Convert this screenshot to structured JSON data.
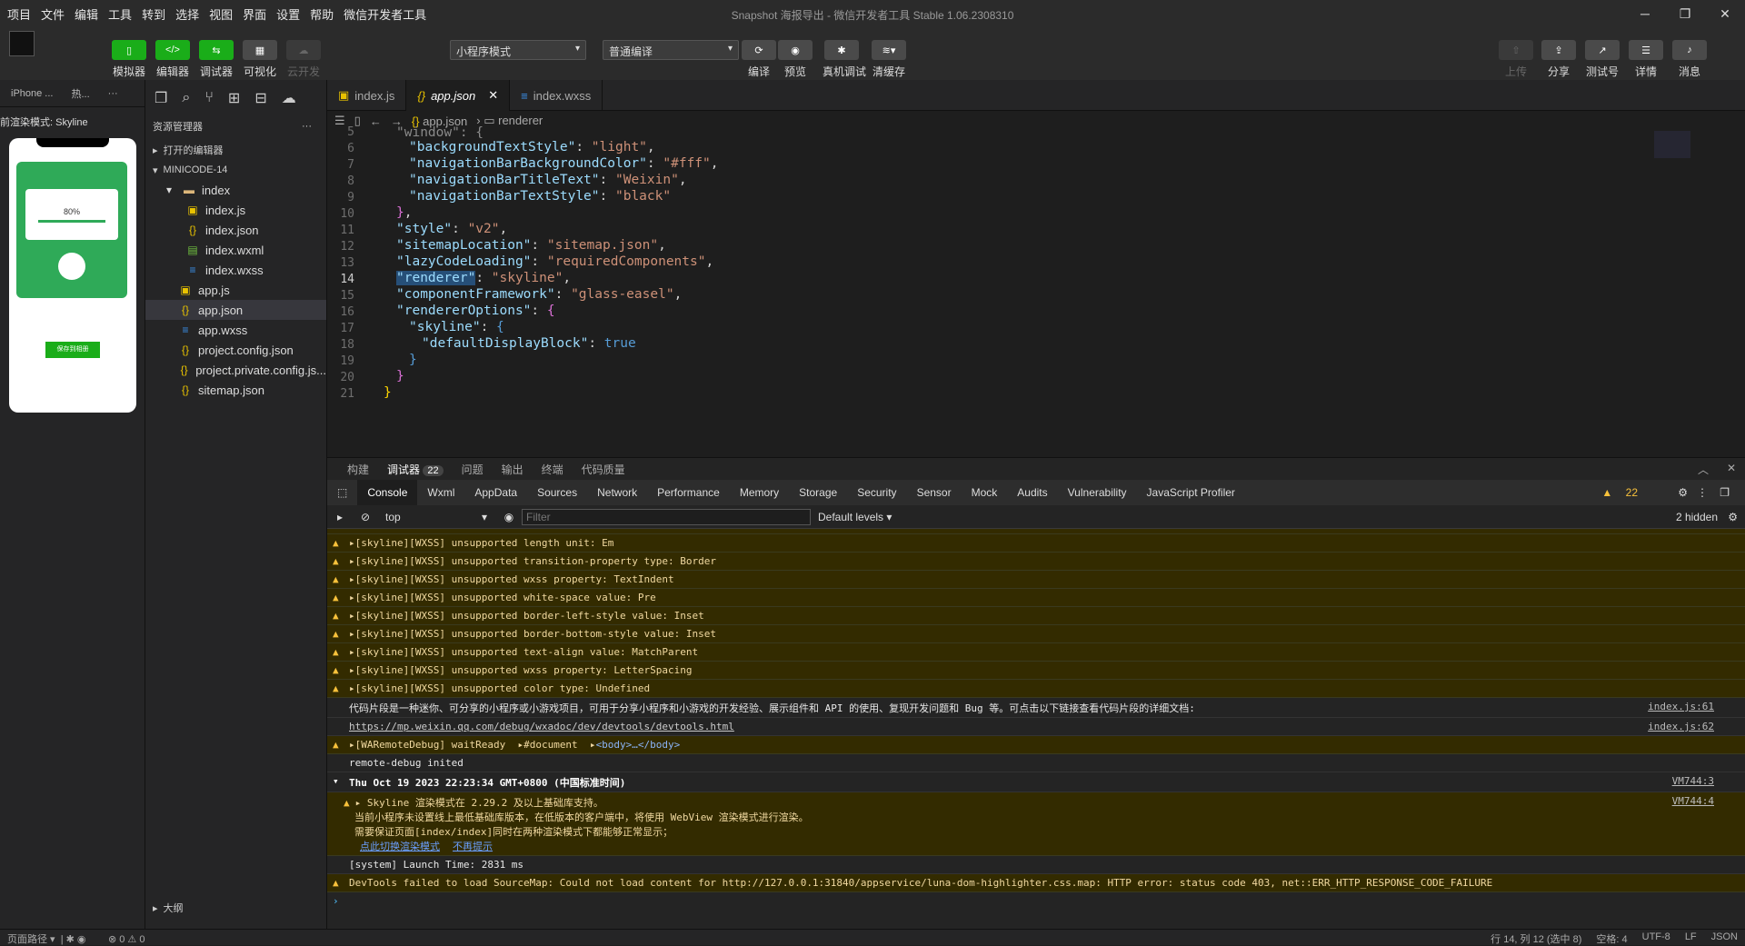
{
  "menu": [
    "项目",
    "文件",
    "编辑",
    "工具",
    "转到",
    "选择",
    "视图",
    "界面",
    "设置",
    "帮助",
    "微信开发者工具"
  ],
  "window_title": "Snapshot 海报导出 - 微信开发者工具 Stable 1.06.2308310",
  "toolbar": {
    "simulator": "模拟器",
    "editor": "编辑器",
    "debugger": "调试器",
    "visual": "可视化",
    "cloud": "云开发",
    "mode_select": "小程序模式",
    "compile_select": "普通编译",
    "compile": "编译",
    "preview": "预览",
    "real_debug": "真机调试",
    "clear_cache": "清缓存",
    "upload": "上传",
    "share": "分享",
    "test": "测试号",
    "details": "详情",
    "messages": "消息"
  },
  "sim": {
    "device": "iPhone ...",
    "hot": "热...",
    "mode_label": "前渲染模式: Skyline",
    "progress": "80%",
    "btn": "保存到相册"
  },
  "files": {
    "title": "资源管理器",
    "open_editors": "打开的编辑器",
    "project": "MINICODE-14",
    "folder": "index",
    "items": [
      "index.js",
      "index.json",
      "index.wxml",
      "index.wxss",
      "app.js",
      "app.json",
      "app.wxss",
      "project.config.json",
      "project.private.config.js...",
      "sitemap.json"
    ],
    "outline": "大纲"
  },
  "tabs": [
    "index.js",
    "app.json",
    "index.wxss"
  ],
  "breadcrumb": {
    "file": "app.json",
    "node": "renderer"
  },
  "code": {
    "l5": "\"window\": {",
    "l6k": "\"backgroundTextStyle\"",
    "l6v": "\"light\"",
    "l7k": "\"navigationBarBackgroundColor\"",
    "l7v": "\"#fff\"",
    "l8k": "\"navigationBarTitleText\"",
    "l8v": "\"Weixin\"",
    "l9k": "\"navigationBarTextStyle\"",
    "l9v": "\"black\"",
    "l11k": "\"style\"",
    "l11v": "\"v2\"",
    "l12k": "\"sitemapLocation\"",
    "l12v": "\"sitemap.json\"",
    "l13k": "\"lazyCodeLoading\"",
    "l13v": "\"requiredComponents\"",
    "l14k": "\"renderer\"",
    "l14v": "\"skyline\"",
    "l15k": "\"componentFramework\"",
    "l15v": "\"glass-easel\"",
    "l16k": "\"rendererOptions\"",
    "l17k": "\"skyline\"",
    "l18k": "\"defaultDisplayBlock\"",
    "l18v": "true"
  },
  "devtop": {
    "build": "构建",
    "debugger": "调试器",
    "count": "22",
    "issues": "问题",
    "output": "输出",
    "terminal": "终端",
    "quality": "代码质量"
  },
  "devtabs": [
    "Console",
    "Wxml",
    "AppData",
    "Sources",
    "Network",
    "Performance",
    "Memory",
    "Storage",
    "Security",
    "Sensor",
    "Mock",
    "Audits",
    "Vulnerability",
    "JavaScript Profiler"
  ],
  "warn_count": "22",
  "filter": {
    "context": "top",
    "placeholder": "Filter",
    "levels": "Default levels",
    "hidden": "2 hidden"
  },
  "console": [
    {
      "t": "w",
      "m": "[skyline][WXSS] unsupported length unit: Em"
    },
    {
      "t": "w",
      "m": "[skyline][WXSS] unsupported transition-property type: Border"
    },
    {
      "t": "w",
      "m": "[skyline][WXSS] unsupported wxss property: TextIndent"
    },
    {
      "t": "w",
      "m": "[skyline][WXSS] unsupported white-space value: Pre"
    },
    {
      "t": "w",
      "m": "[skyline][WXSS] unsupported border-left-style value: Inset"
    },
    {
      "t": "w",
      "m": "[skyline][WXSS] unsupported border-bottom-style value: Inset"
    },
    {
      "t": "w",
      "m": "[skyline][WXSS] unsupported text-align value: MatchParent"
    },
    {
      "t": "w",
      "m": "[skyline][WXSS] unsupported wxss property: LetterSpacing"
    },
    {
      "t": "w",
      "m": "[skyline][WXSS] unsupported color type: Undefined"
    }
  ],
  "info1": "代码片段是一种迷你、可分享的小程序或小游戏项目，可用于分享小程序和小游戏的开发经验、展示组件和 API 的使用、复现开发问题和 Bug 等。可点击以下链接查看代码片段的详细文档:",
  "info1_src": "index.js:61",
  "link1": "https://mp.weixin.qq.com/debug/wxadoc/dev/devtools/devtools.html",
  "link1_src": "index.js:62",
  "remote": "[WARemoteDebug] waitReady",
  "remote_doc": "#document",
  "remote_body": "<body>…</body>",
  "remote_inited": "remote-debug inited",
  "date": "Thu Oct 19 2023 22:23:34 GMT+0800 (中国标准时间)",
  "date_src": "VM744:3",
  "skyline1": "Skyline 渲染模式在 2.29.2 及以上基础库支持。",
  "skyline2": "当前小程序未设置线上最低基础库版本，在低版本的客户端中，将使用 WebView 渲染模式进行渲染。",
  "skyline3": "需要保证页面[index/index]同时在两种渲染模式下都能够正常显示；",
  "skyline_src": "VM744:4",
  "skyline_a": "点此切换渲染模式",
  "skyline_b": "不再提示",
  "launch": "[system] Launch Time: 2831 ms",
  "srcmap": "DevTools failed to load SourceMap: Could not load content for http://127.0.0.1:31840/appservice/luna-dom-highlighter.css.map: HTTP error: status code 403, net::ERR_HTTP_RESPONSE_CODE_FAILURE",
  "status": {
    "path": "页面路径",
    "errs": "⊗ 0 ⚠ 0",
    "pos": "行 14, 列 12 (选中 8)",
    "spaces": "空格: 4",
    "enc": "UTF-8",
    "eol": "LF",
    "lang": "JSON"
  }
}
